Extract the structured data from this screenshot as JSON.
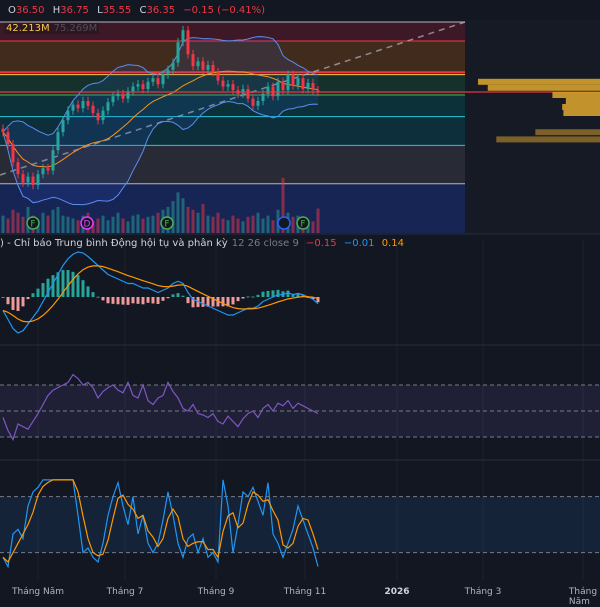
{
  "header": {
    "o_label": "O",
    "o": "36.50",
    "h_label": "H",
    "h": "36.75",
    "l_label": "L",
    "l": "35.55",
    "c_label": "C",
    "c": "36.35",
    "change": "−0.15 (−0.41%)"
  },
  "volume_legend": {
    "value": "42.213M",
    "ma": "75.269M"
  },
  "macd_legend": {
    "title": ") - Chỉ báo Trung bình Động hội tụ và phân kỳ",
    "params": "12 26 close 9",
    "hist": "−0.15",
    "macd": "−0.01",
    "signal": "0.14"
  },
  "x_axis": [
    "Tháng Năm",
    "Tháng 7",
    "Tháng 9",
    "Tháng 11",
    "2026",
    "Tháng 3",
    "Tháng Năm"
  ],
  "colors": {
    "up": "#26a69a",
    "down": "#f23645",
    "bb": "#2962ff",
    "ma": "#f7931a",
    "rsi": "#7e57c2",
    "stoch_k": "#2196f3",
    "stoch_d": "#ff9800",
    "profile": "#e0a82e"
  },
  "events": [
    {
      "letter": "F",
      "color": "#4caf50"
    },
    {
      "letter": "D",
      "color": "#e040fb"
    },
    {
      "letter": "F",
      "color": "#4caf50"
    },
    {
      "letter": "",
      "color": "#2962ff"
    },
    {
      "letter": "F",
      "color": "#4caf50"
    }
  ],
  "chart_data": {
    "type": "candlestick",
    "closes": [
      33.0,
      32.0,
      30.5,
      29.5,
      28.8,
      29.3,
      28.6,
      29.5,
      30.0,
      29.8,
      31.5,
      33.0,
      34.0,
      34.8,
      35.3,
      35.0,
      35.6,
      35.2,
      34.6,
      34.0,
      34.8,
      35.5,
      36.0,
      36.2,
      35.8,
      36.4,
      36.8,
      37.0,
      36.6,
      37.2,
      37.5,
      37.0,
      37.8,
      38.2,
      38.8,
      40.5,
      41.5,
      39.5,
      38.5,
      38.9,
      38.2,
      38.6,
      38.0,
      37.3,
      36.8,
      37.0,
      36.5,
      36.2,
      36.6,
      35.8,
      35.2,
      35.6,
      36.2,
      36.8,
      36.0,
      37.2,
      36.5,
      37.8,
      36.9,
      37.5,
      36.6,
      37.1,
      36.5,
      36.35
    ],
    "volumes_m": [
      30,
      25,
      40,
      35,
      28,
      45,
      30,
      22,
      35,
      30,
      40,
      45,
      30,
      28,
      25,
      22,
      30,
      35,
      20,
      25,
      30,
      22,
      28,
      35,
      25,
      20,
      30,
      32,
      25,
      28,
      30,
      35,
      40,
      45,
      55,
      70,
      60,
      45,
      40,
      35,
      50,
      30,
      28,
      35,
      25,
      22,
      30,
      25,
      20,
      28,
      30,
      35,
      25,
      30,
      22,
      40,
      95,
      35,
      28,
      30,
      25,
      22,
      20,
      42.213
    ],
    "macd": [
      -0.3,
      -0.5,
      -0.7,
      -0.8,
      -0.75,
      -0.6,
      -0.45,
      -0.3,
      -0.1,
      0.1,
      0.3,
      0.5,
      0.7,
      0.85,
      0.95,
      1.0,
      0.98,
      0.9,
      0.8,
      0.7,
      0.6,
      0.5,
      0.45,
      0.4,
      0.35,
      0.3,
      0.3,
      0.25,
      0.2,
      0.2,
      0.15,
      0.1,
      0.15,
      0.2,
      0.3,
      0.35,
      0.3,
      0.1,
      -0.05,
      -0.1,
      -0.15,
      -0.2,
      -0.25,
      -0.3,
      -0.35,
      -0.4,
      -0.4,
      -0.35,
      -0.3,
      -0.25,
      -0.25,
      -0.2,
      -0.1,
      -0.05,
      0,
      0.05,
      0.05,
      0.1,
      0.05,
      0.08,
      0.05,
      0.0,
      -0.05,
      -0.15
    ],
    "rsi": [
      45,
      35,
      28,
      40,
      38,
      36,
      42,
      48,
      55,
      62,
      66,
      68,
      70,
      72,
      78,
      75,
      70,
      72,
      68,
      60,
      65,
      68,
      70,
      66,
      64,
      72,
      62,
      60,
      70,
      58,
      55,
      60,
      62,
      72,
      65,
      60,
      52,
      50,
      55,
      48,
      47,
      45,
      48,
      42,
      40,
      46,
      42,
      38,
      44,
      48,
      50,
      45,
      52,
      55,
      50,
      56,
      54,
      58,
      52,
      56,
      54,
      52,
      50,
      48
    ],
    "rsi_levels": [
      70,
      50,
      30
    ],
    "stoch_k": [
      15,
      5,
      40,
      45,
      35,
      70,
      85,
      90,
      98,
      98,
      98,
      98,
      98,
      98,
      98,
      60,
      20,
      25,
      15,
      10,
      30,
      60,
      80,
      95,
      70,
      50,
      80,
      40,
      60,
      30,
      20,
      30,
      55,
      85,
      60,
      30,
      15,
      35,
      40,
      20,
      35,
      15,
      20,
      10,
      98,
      70,
      20,
      50,
      85,
      80,
      90,
      75,
      60,
      95,
      40,
      30,
      15,
      30,
      45,
      70,
      55,
      40,
      25,
      5
    ],
    "stoch_levels": [
      80,
      20
    ],
    "fib_levels": [
      44.0,
      40.6,
      38.0,
      37.8,
      36.1,
      34.3,
      31.9,
      28.7
    ],
    "volume_profile": [
      {
        "price": 37.2,
        "volume": 100
      },
      {
        "price": 36.7,
        "volume": 92
      },
      {
        "price": 36.1,
        "volume": 39
      },
      {
        "price": 35.6,
        "volume": 28
      },
      {
        "price": 35.1,
        "volume": 31
      },
      {
        "price": 34.6,
        "volume": 30
      },
      {
        "price": 33.0,
        "volume": 53
      },
      {
        "price": 32.4,
        "volume": 85
      }
    ]
  }
}
